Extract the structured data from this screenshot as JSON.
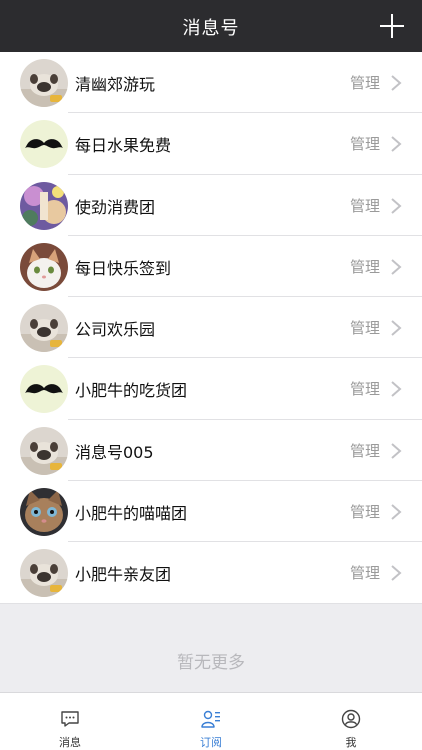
{
  "header": {
    "title": "消息号",
    "add_icon": "plus-icon"
  },
  "subscriptions": [
    {
      "name": "清幽郊游玩",
      "action": "管理",
      "avatar": "pug-photo"
    },
    {
      "name": "每日水果免费",
      "action": "管理",
      "avatar": "mustache-icon"
    },
    {
      "name": "使劲消费团",
      "action": "管理",
      "avatar": "anime-photo"
    },
    {
      "name": "每日快乐签到",
      "action": "管理",
      "avatar": "cat-photo"
    },
    {
      "name": "公司欢乐园",
      "action": "管理",
      "avatar": "pug-photo"
    },
    {
      "name": "小肥牛的吃货团",
      "action": "管理",
      "avatar": "mustache-icon"
    },
    {
      "name": "消息号005",
      "action": "管理",
      "avatar": "pug-photo"
    },
    {
      "name": "小肥牛的喵喵团",
      "action": "管理",
      "avatar": "cat-face-photo"
    },
    {
      "name": "小肥牛亲友团",
      "action": "管理",
      "avatar": "pug-photo"
    }
  ],
  "empty_state": {
    "text": "暂无更多"
  },
  "tabbar": {
    "messages": {
      "label": "消息",
      "icon": "chat-icon"
    },
    "subscribe": {
      "label": "订阅",
      "icon": "subscribe-icon"
    },
    "me": {
      "label": "我",
      "icon": "user-icon"
    }
  },
  "colors": {
    "header_bg": "#2c2c2f",
    "accent": "#3a7fd5",
    "mustache_bg": "#eef3d6"
  }
}
